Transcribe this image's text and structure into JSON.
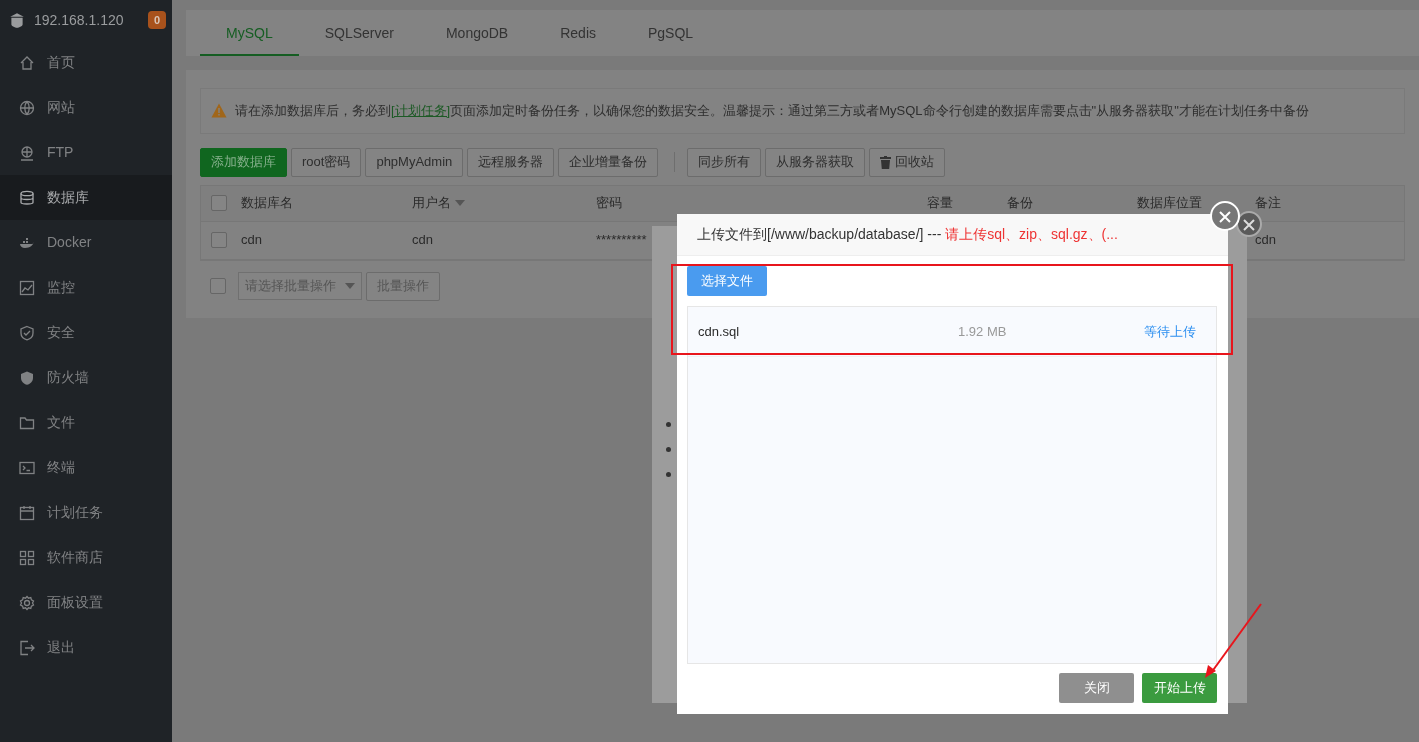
{
  "sidebar": {
    "host": "192.168.1.120",
    "badge": "0",
    "items": [
      {
        "label": "首页",
        "selected": false
      },
      {
        "label": "网站",
        "selected": false
      },
      {
        "label": "FTP",
        "selected": false
      },
      {
        "label": "数据库",
        "selected": true
      },
      {
        "label": "Docker",
        "selected": false
      },
      {
        "label": "监控",
        "selected": false
      },
      {
        "label": "安全",
        "selected": false
      },
      {
        "label": "防火墙",
        "selected": false
      },
      {
        "label": "文件",
        "selected": false
      },
      {
        "label": "终端",
        "selected": false
      },
      {
        "label": "计划任务",
        "selected": false
      },
      {
        "label": "软件商店",
        "selected": false
      },
      {
        "label": "面板设置",
        "selected": false
      },
      {
        "label": "退出",
        "selected": false
      }
    ]
  },
  "tabs": [
    {
      "label": "MySQL",
      "selected": true
    },
    {
      "label": "SQLServer",
      "selected": false
    },
    {
      "label": "MongoDB",
      "selected": false
    },
    {
      "label": "Redis",
      "selected": false
    },
    {
      "label": "PgSQL",
      "selected": false
    }
  ],
  "alert": {
    "before": "请在添加数据库后，务必到",
    "link": "[计划任务]",
    "after": "页面添加定时备份任务，以确保您的数据安全。温馨提示：通过第三方或者MySQL命令行创建的数据库需要点击\"从服务器获取\"才能在计划任务中备份"
  },
  "toolbar": {
    "groups": [
      [
        {
          "label": "添加数据库",
          "kind": "primary"
        },
        {
          "label": "root密码",
          "kind": "plain"
        },
        {
          "label": "phpMyAdmin",
          "kind": "plain"
        },
        {
          "label": "远程服务器",
          "kind": "plain"
        },
        {
          "label": "企业增量备份",
          "kind": "plain"
        }
      ],
      [
        {
          "label": "同步所有",
          "kind": "plain"
        },
        {
          "label": "从服务器获取",
          "kind": "plain"
        },
        {
          "label": "回收站",
          "kind": "trash"
        }
      ]
    ]
  },
  "table": {
    "all_checked": false,
    "columns": [
      {
        "label": "数据库名",
        "sortable": false
      },
      {
        "label": "用户名",
        "sortable": true
      },
      {
        "label": "密码",
        "sortable": false
      },
      {
        "label": "容量",
        "sortable": false
      },
      {
        "label": "备份",
        "sortable": false
      },
      {
        "label": "数据库位置",
        "sortable": false
      },
      {
        "label": "备注",
        "sortable": false
      }
    ],
    "rows": [
      {
        "checked": false,
        "database_name": "cdn",
        "username": "cdn",
        "password": "**********",
        "note": "cdn"
      }
    ]
  },
  "batch": {
    "checked": false,
    "placeholder": "请选择批量操作",
    "button": "批量操作"
  },
  "upload_dialog": {
    "title": "上传文件到[/www/backup/database/] ---",
    "hint": "请上传sql、zip、sql.gz、(...",
    "choose_button": "选择文件",
    "files": [
      {
        "name": "cdn.sql",
        "size": "1.92 MB",
        "status": "等待上传"
      }
    ],
    "buttons": [
      {
        "label": "关闭",
        "kind": "cancel"
      },
      {
        "label": "开始上传",
        "kind": "primary"
      }
    ]
  }
}
